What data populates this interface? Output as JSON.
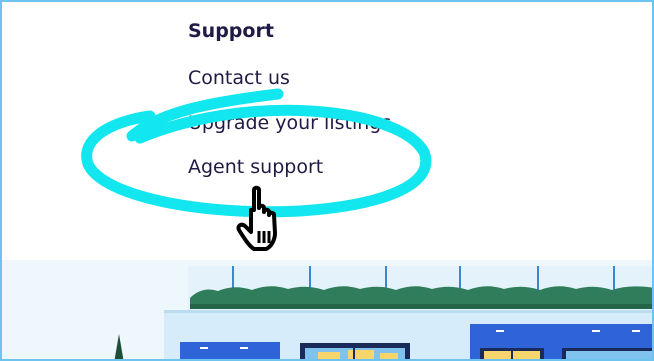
{
  "support_menu": {
    "heading": "Support",
    "links": [
      {
        "label": "Contact us"
      },
      {
        "label": "Upgrade your listings"
      },
      {
        "label": "Agent support"
      }
    ]
  },
  "annotation": {
    "highlight_color": "#12e6ee",
    "cursor": "hand-pointer-icon"
  },
  "colors": {
    "text": "#1f1b45",
    "border": "#6fc3ef",
    "hedge": "#2f7d5a",
    "building_blue": "#2f63d8",
    "window_yellow": "#f7d56a"
  }
}
